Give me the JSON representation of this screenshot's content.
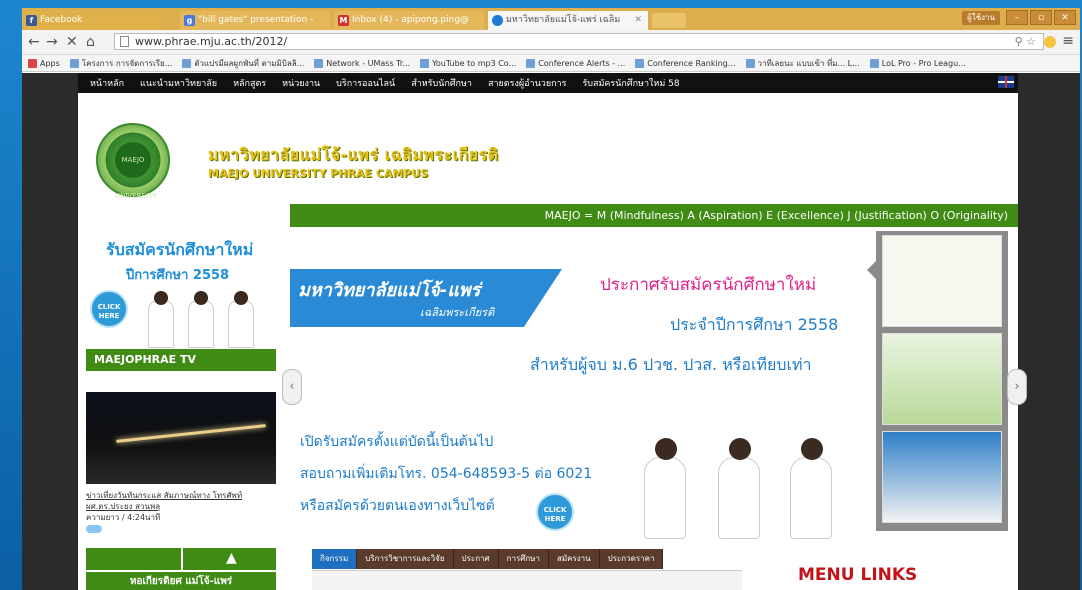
{
  "browser": {
    "tabs": [
      {
        "label": "Facebook",
        "icon": "facebook-icon"
      },
      {
        "label": "\"bill gates\" presentation -",
        "icon": "google-icon"
      },
      {
        "label": "Inbox (4) - apipong.ping@",
        "icon": "gmail-icon"
      },
      {
        "label": "มหาวิทยาลัยแม่โจ้-แพร่ เฉลิม",
        "icon": "chrome-page-icon"
      }
    ],
    "user_button": "ผู้ใช้งาน",
    "url": "www.phrae.mju.ac.th/2012/",
    "bookmarks": [
      "Apps",
      "โครงการ การจัดการเรีย...",
      "ตัวแปรมีผลผูกพันที่ ตามมิบิลลิ...",
      "Network - UMass Tr...",
      "YouTube to mp3 Co...",
      "Conference Alerts - ...",
      "Conference Ranking...",
      "วาทีเลยนะ แบบเข้า ที่ม... L...",
      "LoL Pro - Pro Leagu..."
    ]
  },
  "site": {
    "nav": [
      "หน้าหลัก",
      "แนะนำมหาวิทยาลัย",
      "หลักสูตร",
      "หน่วยงาน",
      "บริการออนไลน์",
      "สำหรับนักศึกษา",
      "สายตรงผู้อำนวยการ",
      "รับสมัครนักศึกษาใหม่ 58"
    ],
    "logo_text": "MAEJO UNIVERSITY",
    "univ_name_th": "มหาวิทยาลัยแม่โจ้-แพร่ เฉลิมพระเกียรติ",
    "univ_name_en": "MAEJO UNIVERSITY PHRAE CAMPUS",
    "motto": "MAEJO = M (Mindfulness) A (Aspiration) E (Excellence) J (Justification) O (Originality)",
    "left": {
      "apply_title": "รับสมัครนักศึกษาใหม่",
      "apply_year": "ปีการศึกษา 2558",
      "click_here": "CLICK HERE",
      "tv_title": "MAEJOPHRAE TV",
      "video_caption": "ข่าวเที่ยงวันทันกระแส สัมภาษณ์ทาง โทรศัพท์ ผศ.ดร.ประยง สวนพลุ",
      "video_meta": "ความยาว / 4:24นาที",
      "library": "หอเกียรติยศ แม่โจ้-แพร่"
    },
    "banner": {
      "tag_title": "มหาวิทยาลัยแม่โจ้-แพร่",
      "tag_sub": "เฉลิมพระเกียรติ",
      "headline1": "ประกาศรับสมัครนักศึกษาใหม่",
      "headline2": "ประจำปีการศึกษา 2558",
      "headline3": "สำหรับผู้จบ ม.6 ปวช. ปวส. หรือเทียบเท่า",
      "open1": "เปิดรับสมัครตั้งแต่บัดนี้เป็นต้นไป",
      "open2": "สอบถามเพิ่มเติมโทร. 054-648593-5 ต่อ 6021",
      "open3": "หรือสมัครด้วยตนเองทางเว็บไซต์",
      "click_here": "CLICK HERE"
    },
    "bottom_tabs": [
      "กิจกรรม",
      "บริการวิชาการและวิจัย",
      "ประกาศ",
      "การศึกษา",
      "สมัครงาน",
      "ประกวดราคา"
    ],
    "menu_links": "MENU LINKS"
  }
}
